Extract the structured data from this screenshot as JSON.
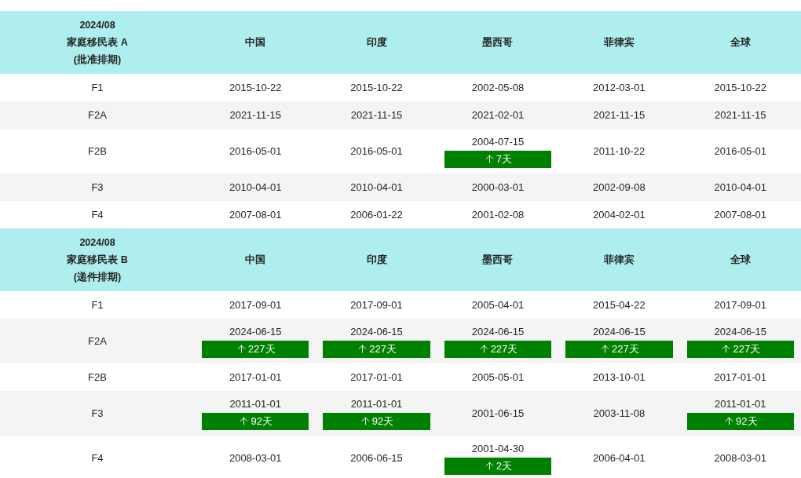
{
  "tables": [
    {
      "title_lines": [
        "2024/08",
        "家庭移民表 A",
        "(批准排期)"
      ],
      "columns": [
        "中国",
        "印度",
        "墨西哥",
        "菲律宾",
        "全球"
      ],
      "rows": [
        {
          "category": "F1",
          "cells": [
            {
              "date": "2015-10-22"
            },
            {
              "date": "2015-10-22"
            },
            {
              "date": "2002-05-08"
            },
            {
              "date": "2012-03-01"
            },
            {
              "date": "2015-10-22"
            }
          ]
        },
        {
          "category": "F2A",
          "cells": [
            {
              "date": "2021-11-15"
            },
            {
              "date": "2021-11-15"
            },
            {
              "date": "2021-02-01"
            },
            {
              "date": "2021-11-15"
            },
            {
              "date": "2021-11-15"
            }
          ]
        },
        {
          "category": "F2B",
          "cells": [
            {
              "date": "2016-05-01"
            },
            {
              "date": "2016-05-01"
            },
            {
              "date": "2004-07-15",
              "change": "7天"
            },
            {
              "date": "2011-10-22"
            },
            {
              "date": "2016-05-01"
            }
          ]
        },
        {
          "category": "F3",
          "cells": [
            {
              "date": "2010-04-01"
            },
            {
              "date": "2010-04-01"
            },
            {
              "date": "2000-03-01"
            },
            {
              "date": "2002-09-08"
            },
            {
              "date": "2010-04-01"
            }
          ]
        },
        {
          "category": "F4",
          "cells": [
            {
              "date": "2007-08-01"
            },
            {
              "date": "2006-01-22"
            },
            {
              "date": "2001-02-08"
            },
            {
              "date": "2004-02-01"
            },
            {
              "date": "2007-08-01"
            }
          ]
        }
      ]
    },
    {
      "title_lines": [
        "2024/08",
        "家庭移民表 B",
        "(递件排期)"
      ],
      "columns": [
        "中国",
        "印度",
        "墨西哥",
        "菲律宾",
        "全球"
      ],
      "rows": [
        {
          "category": "F1",
          "cells": [
            {
              "date": "2017-09-01"
            },
            {
              "date": "2017-09-01"
            },
            {
              "date": "2005-04-01"
            },
            {
              "date": "2015-04-22"
            },
            {
              "date": "2017-09-01"
            }
          ]
        },
        {
          "category": "F2A",
          "cells": [
            {
              "date": "2024-06-15",
              "change": "227天"
            },
            {
              "date": "2024-06-15",
              "change": "227天"
            },
            {
              "date": "2024-06-15",
              "change": "227天"
            },
            {
              "date": "2024-06-15",
              "change": "227天"
            },
            {
              "date": "2024-06-15",
              "change": "227天"
            }
          ]
        },
        {
          "category": "F2B",
          "cells": [
            {
              "date": "2017-01-01"
            },
            {
              "date": "2017-01-01"
            },
            {
              "date": "2005-05-01"
            },
            {
              "date": "2013-10-01"
            },
            {
              "date": "2017-01-01"
            }
          ]
        },
        {
          "category": "F3",
          "cells": [
            {
              "date": "2011-01-01",
              "change": "92天"
            },
            {
              "date": "2011-01-01",
              "change": "92天"
            },
            {
              "date": "2001-06-15"
            },
            {
              "date": "2003-11-08"
            },
            {
              "date": "2011-01-01",
              "change": "92天"
            }
          ]
        },
        {
          "category": "F4",
          "cells": [
            {
              "date": "2008-03-01"
            },
            {
              "date": "2006-06-15"
            },
            {
              "date": "2001-04-30",
              "change": "2天"
            },
            {
              "date": "2006-04-01"
            },
            {
              "date": "2008-03-01"
            }
          ]
        }
      ]
    }
  ]
}
